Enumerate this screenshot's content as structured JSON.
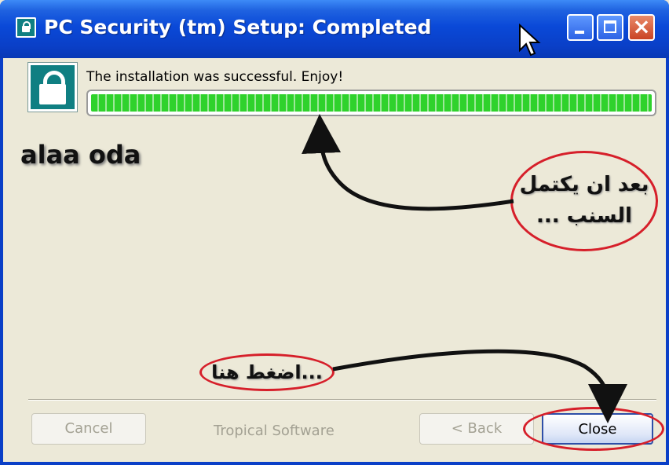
{
  "window": {
    "title": "PC Security (tm) Setup: Completed",
    "icons": {
      "app": "lock-icon",
      "minimize": "minimize-icon",
      "maximize": "maximize-icon",
      "close": "close-icon",
      "cursor": "mouse-cursor-icon"
    }
  },
  "content": {
    "message": "The installation was successful. Enjoy!",
    "progress_percent": 100,
    "watermark": "alaa oda"
  },
  "annotations": {
    "callout_top": "بعد ان يكتمل السنب ...",
    "callout_bottom": "...اضغط هنا"
  },
  "footer": {
    "cancel_label": "Cancel",
    "brand": "Tropical Software",
    "back_label": "< Back",
    "close_label": "Close"
  },
  "colors": {
    "titlebar": "#0a49d8",
    "progress": "#2fd22c",
    "annotation_ring": "#d61f2a",
    "icon_teal": "#0f7f82"
  }
}
